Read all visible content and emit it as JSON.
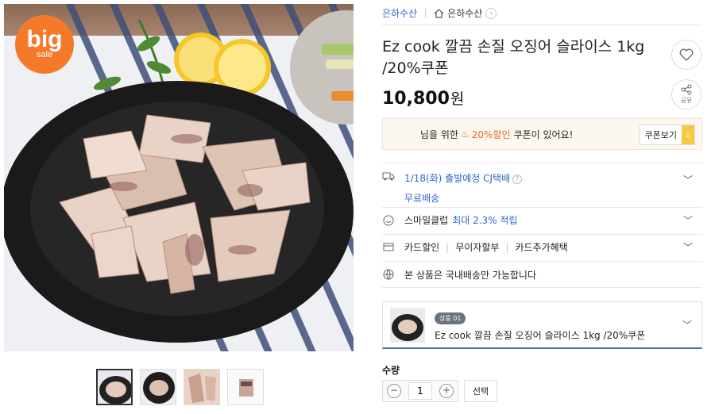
{
  "badge": {
    "line1": "big",
    "line2": "sale"
  },
  "seller": {
    "name": "은하수산",
    "store_name": "은하수산",
    "store_arrow": "›"
  },
  "product": {
    "title": "Ez cook 깔끔 손질 오징어 슬라이스 1kg /20%쿠폰",
    "price": "10,800",
    "currency": "원"
  },
  "actions": {
    "share_label": "공유"
  },
  "coupon": {
    "prefix": "님을 위한",
    "highlight": "20%할인",
    "suffix": "쿠폰이 있어요!",
    "button_label": "쿠폰보기",
    "button_icon": "⇣"
  },
  "shipping": {
    "date_text": "1/18(화) 출발예정 CJ택배",
    "free_label": "무료배송",
    "help": "?"
  },
  "smileclub": {
    "prefix": "스마일클럽",
    "rate": "최대 2.3% 적립"
  },
  "card": {
    "items": [
      "카드할인",
      "무이자할부",
      "카드추가혜택"
    ]
  },
  "notice": {
    "text": "본 상품은 국내배송만 가능합니다"
  },
  "option": {
    "badge": "상품 01",
    "name": "Ez cook 깔끔 손질 오징어 슬라이스 1kg /20%쿠폰"
  },
  "quantity": {
    "label": "수량",
    "value": "1",
    "minus": "−",
    "plus": "+",
    "select_label": "선택"
  },
  "icons": {
    "heart": "heart-icon",
    "share": "share-icon",
    "truck": "truck-icon",
    "smile": "smile-icon",
    "card": "card-icon",
    "globe": "globe-icon",
    "home": "home-icon"
  },
  "colors": {
    "link_blue": "#3366cc",
    "coupon_orange": "#e86c1f",
    "badge_orange": "#f47a2a",
    "select_border": "#4d6fb8"
  }
}
